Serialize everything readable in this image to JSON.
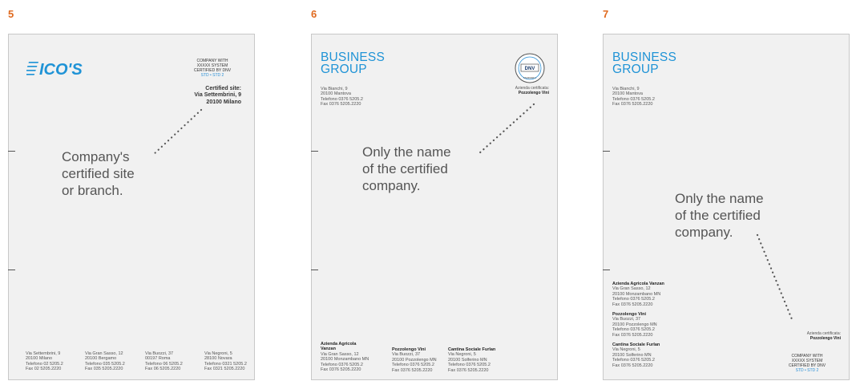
{
  "page5": {
    "number": "5",
    "logo": "ICO'S",
    "cert_lines": [
      "COMPANY WITH",
      "XXXXX SYSTEM",
      "CERTIFIED BY DNV"
    ],
    "cert_std": "STD • STD 2",
    "site_lines": [
      "Certified site:",
      "Via Settembrini, 9",
      "20100 Milano"
    ],
    "annotation": [
      "Company's",
      "certified site",
      "or branch."
    ],
    "footer": [
      [
        "Via Settembrini, 9",
        "20100 Milano",
        "Telefono 02 5205.2",
        "Fax 02 5205.2220"
      ],
      [
        "Via Gran Sasso, 12",
        "20100 Bergamo",
        "Telefono 035 5205.2",
        "Fax 035 5205.2220"
      ],
      [
        "Via Buozzi, 37",
        "00197 Roma",
        "Telefono 06 5205.2",
        "Fax 06 5205.2220"
      ],
      [
        "Via Negroni, 5",
        "28100 Novara",
        "Telefono 0321 5205.2",
        "Fax 0321 5205.2220"
      ]
    ]
  },
  "page6": {
    "number": "6",
    "logo_lines": [
      "BUSINESS",
      "GROUP"
    ],
    "address": [
      "Via Bianchi, 9",
      "20100 Mantova",
      "Telefono 0376 5205.2",
      "Fax 0376 5205.2220"
    ],
    "badge_text": "DNV",
    "badge_ring": "CERTIFIED MANAGEMENT SYSTEM",
    "badge_std": "STANDARD 1",
    "cert_label": "Azienda certificata:",
    "cert_name": "Pozzolengo Vini",
    "annotation": [
      "Only the name",
      "of the certified",
      "company."
    ],
    "footer": [
      {
        "name": "Azienda Agricola Vanzan",
        "lines": [
          "Via Gran Sasso, 12",
          "20100 Monzambano MN",
          "Telefono 0376 5205.2",
          "Fax 0376 5205.2220"
        ]
      },
      {
        "name": "Pozzolengo Vini",
        "lines": [
          "Via Buozzi, 37",
          "20100 Pozzolengo MN",
          "Telefono 0376 5205.2",
          "Fax 0376 5205.2220"
        ]
      },
      {
        "name": "Cantina Sociale Furlan",
        "lines": [
          "Via Negroni, 5",
          "20100 Solferino MN",
          "Telefono 0376 5205.2",
          "Fax 0376 5205.2220"
        ]
      }
    ]
  },
  "page7": {
    "number": "7",
    "logo_lines": [
      "BUSINESS",
      "GROUP"
    ],
    "address": [
      "Via Bianchi, 9",
      "20100 Mantova",
      "Telefono 0376 5205.2",
      "Fax 0376 5205.2220"
    ],
    "annotation": [
      "Only the name",
      "of the certified",
      "company."
    ],
    "entries": [
      {
        "name": "Azienda Agricola Vanzan",
        "lines": [
          "Via Gran Sasso, 12",
          "20100 Monzambano MN",
          "Telefono 0376 5205.2",
          "Fax 0376 5205.2220"
        ]
      },
      {
        "name": "Pozzolengo Vini",
        "lines": [
          "Via Buozzi, 37",
          "20100 Pozzolengo MN",
          "Telefono 0376 5205.2",
          "Fax 0376 5205.2220"
        ]
      },
      {
        "name": "Cantina Sociale Furlan",
        "lines": [
          "Via Negroni, 5",
          "20100 Solferino MN",
          "Telefono 0376 5205.2",
          "Fax 0376 5205.2220"
        ]
      }
    ],
    "cert_label": "Azienda certificata:",
    "cert_name": "Pozzolengo Vini",
    "cert_lines": [
      "COMPANY WITH",
      "XXXXX SYSTEM",
      "CERTIFIED BY DNV"
    ],
    "cert_std": "STD • STD 2"
  },
  "colors": {
    "number": "#e06a1f",
    "logo": "#1f93d6",
    "page_bg": "#f1f1f1",
    "text": "#555555"
  }
}
